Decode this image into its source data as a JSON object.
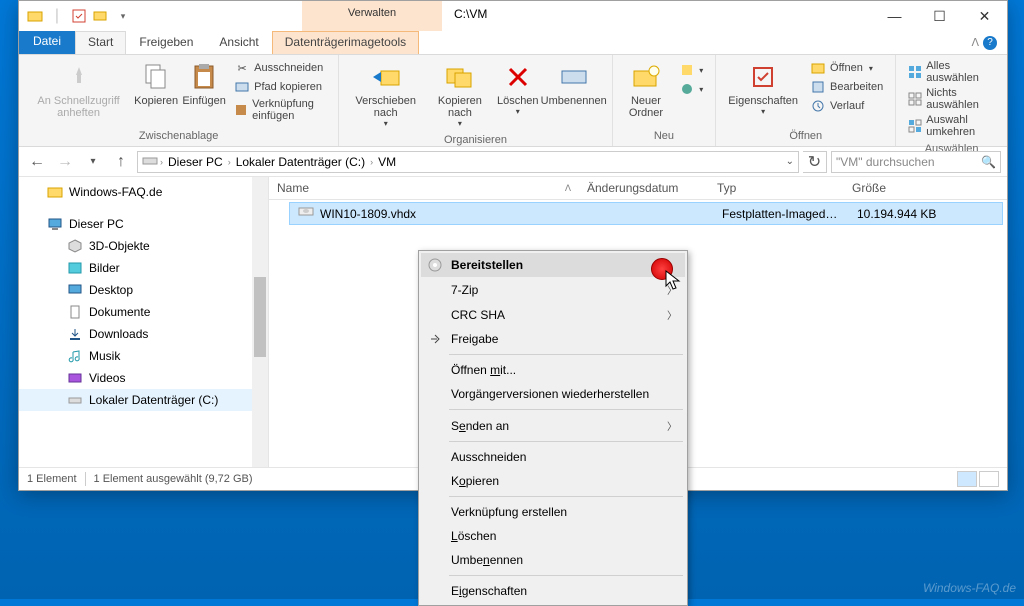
{
  "window": {
    "contextual_tab": "Verwalten",
    "title": "C:\\VM"
  },
  "tabs": {
    "file": "Datei",
    "start": "Start",
    "share": "Freigeben",
    "view": "Ansicht",
    "tools": "Datenträgerimagetools"
  },
  "ribbon": {
    "clipboard": {
      "pin": "An Schnellzugriff anheften",
      "copy": "Kopieren",
      "paste": "Einfügen",
      "cut": "Ausschneiden",
      "copy_path": "Pfad kopieren",
      "paste_link": "Verknüpfung einfügen",
      "label": "Zwischenablage"
    },
    "organize": {
      "move": "Verschieben nach",
      "copy_to": "Kopieren nach",
      "delete": "Löschen",
      "rename": "Umbenennen",
      "label": "Organisieren"
    },
    "new": {
      "new_folder": "Neuer Ordner",
      "label": "Neu"
    },
    "open": {
      "properties": "Eigenschaften",
      "open": "Öffnen",
      "edit": "Bearbeiten",
      "history": "Verlauf",
      "label": "Öffnen"
    },
    "select": {
      "all": "Alles auswählen",
      "none": "Nichts auswählen",
      "invert": "Auswahl umkehren",
      "label": "Auswählen"
    }
  },
  "breadcrumb": {
    "pc": "Dieser PC",
    "drive": "Lokaler Datenträger (C:)",
    "folder": "VM"
  },
  "search": {
    "placeholder": "\"VM\" durchsuchen"
  },
  "tree": {
    "faq": "Windows-FAQ.de",
    "pc": "Dieser PC",
    "objects3d": "3D-Objekte",
    "pictures": "Bilder",
    "desktop": "Desktop",
    "documents": "Dokumente",
    "downloads": "Downloads",
    "music": "Musik",
    "videos": "Videos",
    "drive": "Lokaler Datenträger (C:)"
  },
  "columns": {
    "name": "Name",
    "date": "Änderungsdatum",
    "type": "Typ",
    "size": "Größe"
  },
  "file": {
    "name": "WIN10-1809.vhdx",
    "type": "Festplatten-Imagedat...",
    "size": "10.194.944 KB"
  },
  "status": {
    "count": "1 Element",
    "selected": "1 Element ausgewählt (9,72 GB)"
  },
  "context_menu": {
    "mount": "Bereitstellen",
    "sevenzip": "7-Zip",
    "crc": "CRC SHA",
    "share": "Freigabe",
    "open_with": "Öffnen mit...",
    "prev_versions": "Vorgängerversionen wiederherstellen",
    "send_to": "Senden an",
    "cut": "Ausschneiden",
    "copy": "Kopieren",
    "shortcut": "Verknüpfung erstellen",
    "delete": "Löschen",
    "rename": "Umbenennen",
    "properties": "Eigenschaften"
  },
  "watermark": "Windows-FAQ.de"
}
